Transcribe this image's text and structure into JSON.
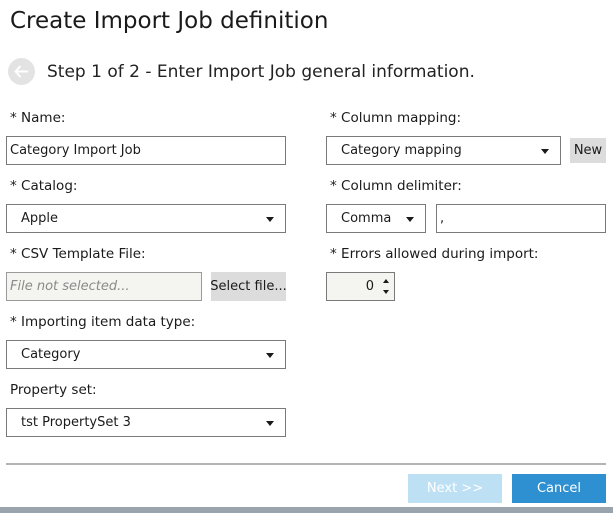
{
  "header": {
    "title": "Create Import Job definition",
    "step_text": "Step 1 of 2 - Enter Import Job general information."
  },
  "form": {
    "name": {
      "label": "* Name:",
      "value": "Category Import Job"
    },
    "catalog": {
      "label": "* Catalog:",
      "value": "Apple"
    },
    "csv_template": {
      "label": "* CSV Template File:",
      "placeholder": "File not selected...",
      "select_button": "Select file..."
    },
    "item_type": {
      "label": "* Importing item data type:",
      "value": "Category"
    },
    "property_set": {
      "label": "Property set:",
      "value": "tst PropertySet 3"
    },
    "column_mapping": {
      "label": "* Column mapping:",
      "value": "Category mapping",
      "new_button": "New"
    },
    "column_delimiter": {
      "label": "* Column delimiter:",
      "value": "Comma",
      "custom_value": ","
    },
    "errors_allowed": {
      "label": "* Errors allowed during import:",
      "value": "0"
    }
  },
  "footer": {
    "next_label": "Next >>",
    "cancel_label": "Cancel"
  },
  "colors": {
    "primary_button": "#2e8fd1",
    "disabled_button": "#bde0f5"
  }
}
